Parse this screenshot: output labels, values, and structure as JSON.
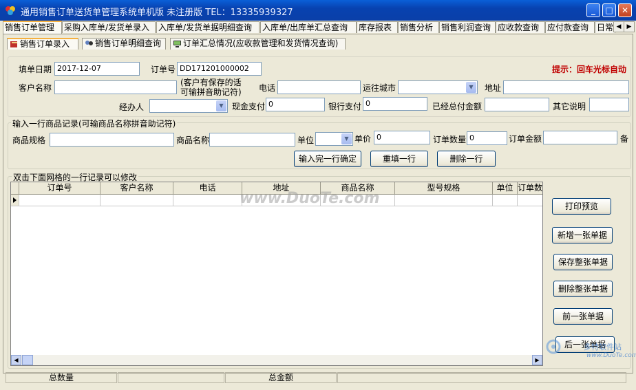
{
  "window": {
    "title": "通用销售订单送货单管理系统单机版   未注册版  TEL：13335939327",
    "min": "_",
    "max": "□",
    "close": "✕"
  },
  "main_tabs": [
    "销售订单管理",
    "采购入库单/发货单录入",
    "入库单/发货单据明细查询",
    "入库单/出库单汇总查询",
    "库存报表",
    "销售分析",
    "销售利润查询",
    "应收款查询",
    "应付款查询",
    "日常"
  ],
  "sub_tabs": [
    "销售订单录入",
    "销售订单明细查询",
    "订单汇总情况(应收款管理和发货情况查询)"
  ],
  "header_form": {
    "date_label": "填单日期",
    "date_value": "2017-12-07",
    "order_no_label": "订单号",
    "order_no_value": "DD171201000002",
    "hint": "提示：回车光标自动",
    "customer_label": "客户名称",
    "customer_note": "(客户有保存的话\n可输拼音助记符)",
    "phone_label": "电话",
    "city_label": "运往城市",
    "address_label": "地址",
    "handler_label": "经办人",
    "cash_label": "现金支付",
    "cash_value": "0",
    "bank_label": "银行支付",
    "bank_value": "0",
    "paid_label": "已经总付金额",
    "other_label": "其它说明"
  },
  "item_group": {
    "title": "输入一行商品记录(可输商品名称拼音助记符)",
    "spec_label": "商品规格",
    "name_label": "商品名称",
    "unit_label": "单位",
    "price_label": "单价",
    "price_value": "0",
    "qty_label": "订单数量",
    "qty_value": "0",
    "amount_label": "订单金额",
    "remark_label": "备",
    "confirm_button": "输入完一行确定",
    "refill_button": "重填一行",
    "delete_button": "删除一行"
  },
  "grid": {
    "title": "双击下面网格的一行记录可以修改",
    "columns": [
      "订单号",
      "客户名称",
      "电话",
      "地址",
      "商品名称",
      "型号规格",
      "单位",
      "订单数量"
    ]
  },
  "side_buttons": [
    "打印预览",
    "新增一张单据",
    "保存整张单据",
    "删除整张单据",
    "前一张单据",
    "后一张单据"
  ],
  "status": {
    "total_qty_label": "总数量",
    "total_amount_label": "总金额"
  },
  "watermarks": {
    "center": "www.DuoTe.com",
    "corner_brand": "多特软件站",
    "corner_url": "www.DuoTe.com"
  },
  "colors": {
    "title_bar": "#0a4fc8",
    "hint": "#c00000",
    "active_tab_accent": "#f5b040"
  }
}
